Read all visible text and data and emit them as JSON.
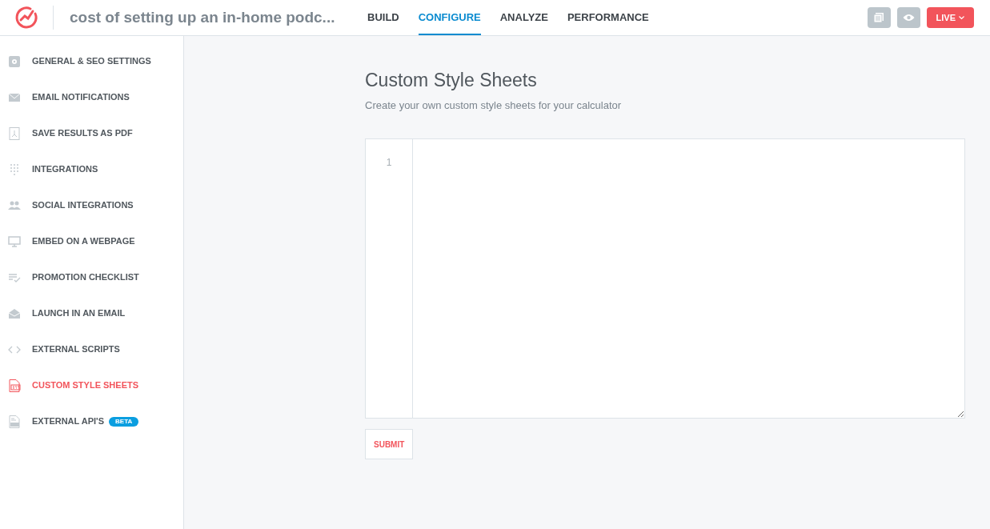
{
  "header": {
    "title": "cost of setting up an in-home podc...",
    "tabs": [
      {
        "label": "BUILD",
        "selected": false
      },
      {
        "label": "CONFIGURE",
        "selected": true
      },
      {
        "label": "ANALYZE",
        "selected": false
      },
      {
        "label": "PERFORMANCE",
        "selected": false
      }
    ],
    "live_button": "LIVE"
  },
  "sidebar": {
    "items": [
      {
        "label": "GENERAL & SEO SETTINGS",
        "selected": false
      },
      {
        "label": "EMAIL NOTIFICATIONS",
        "selected": false
      },
      {
        "label": "SAVE RESULTS AS PDF",
        "selected": false
      },
      {
        "label": "INTEGRATIONS",
        "selected": false
      },
      {
        "label": "SOCIAL INTEGRATIONS",
        "selected": false
      },
      {
        "label": "EMBED ON A WEBPAGE",
        "selected": false
      },
      {
        "label": "PROMOTION CHECKLIST",
        "selected": false
      },
      {
        "label": "LAUNCH IN AN EMAIL",
        "selected": false
      },
      {
        "label": "EXTERNAL SCRIPTS",
        "selected": false
      },
      {
        "label": "CUSTOM STYLE SHEETS",
        "selected": true
      },
      {
        "label": "EXTERNAL API'S",
        "selected": false,
        "badge": "BETA"
      }
    ]
  },
  "main": {
    "title": "Custom Style Sheets",
    "subtitle": "Create your own custom style sheets for your calculator",
    "editor": {
      "line_numbers": [
        "1"
      ]
    },
    "submit": "SUBMIT"
  }
}
